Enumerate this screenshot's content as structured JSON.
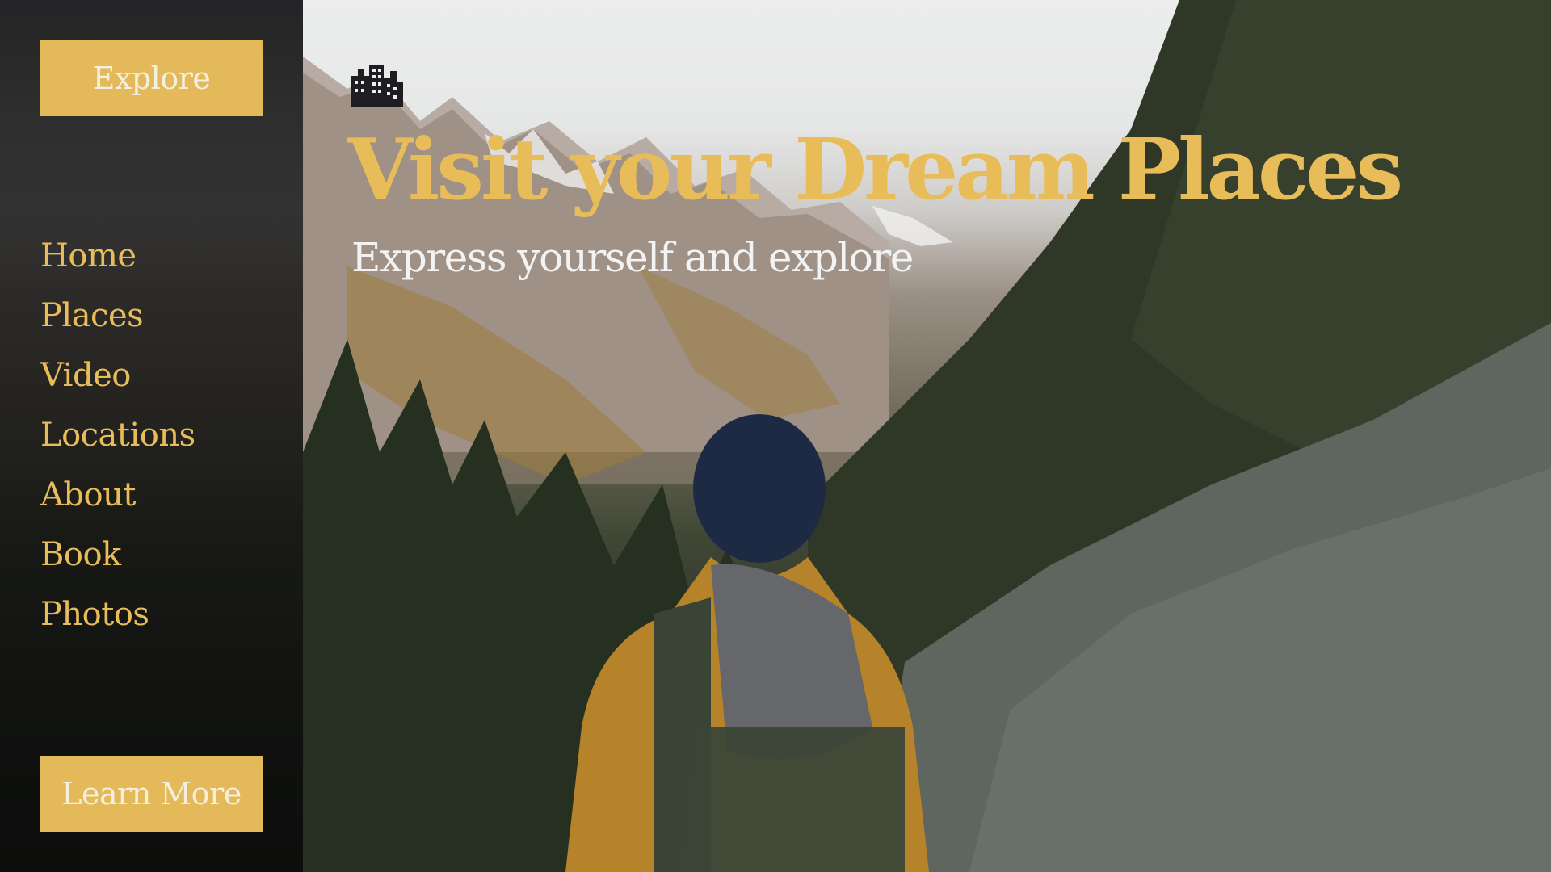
{
  "sidebar": {
    "explore_label": "Explore",
    "learn_more_label": "Learn More",
    "nav_items": [
      {
        "label": "Home"
      },
      {
        "label": "Places"
      },
      {
        "label": "Video"
      },
      {
        "label": "Locations"
      },
      {
        "label": "About"
      },
      {
        "label": "Book"
      },
      {
        "label": "Photos"
      }
    ]
  },
  "hero": {
    "logo_icon": "city-buildings-icon",
    "headline": "Visit your Dream Places",
    "subheadline": "Express yourself and explore"
  },
  "colors": {
    "accent": "#e3b95a",
    "headline": "#e8bd59",
    "sidebar_bg": "#141414",
    "subheadline": "#f3f3f3"
  }
}
